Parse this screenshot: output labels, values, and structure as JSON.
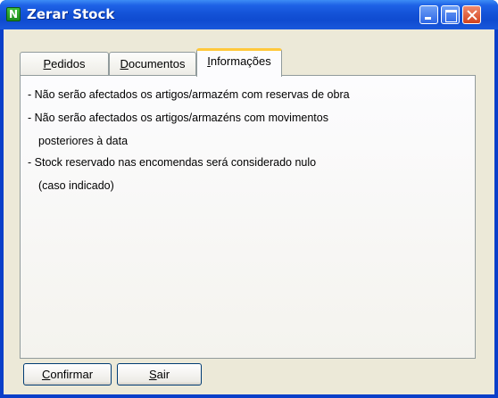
{
  "window": {
    "title": "Zerar Stock",
    "app_icon_letter": "N"
  },
  "tabs": [
    {
      "label": "Pedidos",
      "active": false
    },
    {
      "label": "Documentos",
      "active": false
    },
    {
      "label": "Informações",
      "active": true
    }
  ],
  "info": {
    "lines": [
      "- Não serão afectados os artigos/armazém com reservas de obra",
      "- Não serão afectados os artigos/armazéns com movimentos",
      "posteriores à data",
      "- Stock reservado nas encomendas será considerado nulo",
      "(caso indicado)"
    ]
  },
  "buttons": {
    "confirm_label": "Confirmar",
    "exit_label": "Sair"
  },
  "colors": {
    "titlebar": "#1453d8",
    "client_bg": "#ece9d8",
    "active_tab_accent": "#ffc83c"
  }
}
